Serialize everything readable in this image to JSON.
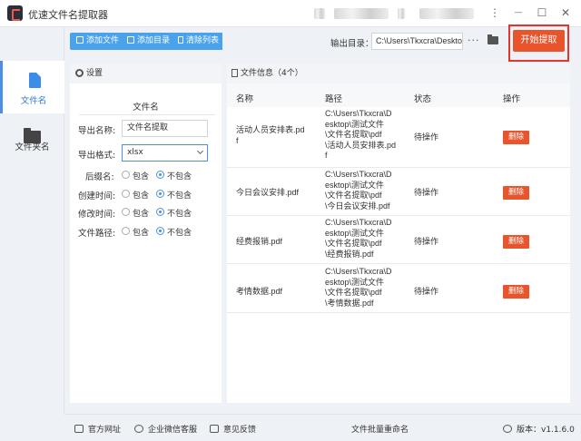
{
  "window": {
    "title": "优速文件名提取器",
    "minimize": "—",
    "maximize": "☐",
    "close": "✕",
    "menu_icon": "⋮"
  },
  "sidebar": {
    "items": [
      {
        "label": "文件名",
        "icon": "file-icon",
        "active": true
      },
      {
        "label": "文件夹名",
        "icon": "folder-icon",
        "active": false
      }
    ]
  },
  "toolbar": {
    "add_file": "添加文件",
    "add_dir": "添加目录",
    "clear_list": "清除列表",
    "output_label": "输出目录：",
    "output_path": "C:\\Users\\Tkxcra\\Desktop",
    "more": "···",
    "start": "开始提取"
  },
  "settings": {
    "header": "设置",
    "section_title": "文件名",
    "export_name_label": "导出名称:",
    "export_name_value": "文件名提取",
    "export_format_label": "导出格式:",
    "export_format_value": "xlsx",
    "options": [
      {
        "label": "后缀名:",
        "include": "包含",
        "exclude": "不包含",
        "selected": "exclude"
      },
      {
        "label": "创建时间:",
        "include": "包含",
        "exclude": "不包含",
        "selected": "exclude"
      },
      {
        "label": "修改时间:",
        "include": "包含",
        "exclude": "不包含",
        "selected": "exclude"
      },
      {
        "label": "文件路径:",
        "include": "包含",
        "exclude": "不包含",
        "selected": "exclude"
      }
    ]
  },
  "file_info": {
    "header": "文件信息（4个）",
    "columns": [
      "名称",
      "路径",
      "状态",
      "操作"
    ],
    "rows": [
      {
        "name": [
          "活动人员安排表.pd",
          "f"
        ],
        "path": [
          "C:\\Users\\Tkxcra\\D",
          "esktop\\测试文件",
          "\\文件名提取\\pdf",
          "\\活动人员安排表.pd",
          "f"
        ],
        "status": "待操作",
        "action": "删除"
      },
      {
        "name": [
          "今日会议安排.pdf"
        ],
        "path": [
          "C:\\Users\\Tkxcra\\D",
          "esktop\\测试文件",
          "\\文件名提取\\pdf",
          "\\今日会议安排.pdf"
        ],
        "status": "待操作",
        "action": "删除"
      },
      {
        "name": [
          "经费报销.pdf"
        ],
        "path": [
          "C:\\Users\\Tkxcra\\D",
          "esktop\\测试文件",
          "\\文件名提取\\pdf",
          "\\经费报销.pdf"
        ],
        "status": "待操作",
        "action": "删除"
      },
      {
        "name": [
          "考情数据.pdf"
        ],
        "path": [
          "C:\\Users\\Tkxcra\\D",
          "esktop\\测试文件",
          "\\文件名提取\\pdf",
          "\\考情数据.pdf"
        ],
        "status": "待操作",
        "action": "删除"
      }
    ]
  },
  "footer": {
    "website": "官方网址",
    "wechat": "企业微信客服",
    "feedback": "意见反馈",
    "center": "文件批量重命名",
    "version": "版本：v1.1.6.0"
  },
  "colors": {
    "accent": "#4aa3ea",
    "start_button": "#e8542b",
    "highlight": "#e5342b"
  }
}
